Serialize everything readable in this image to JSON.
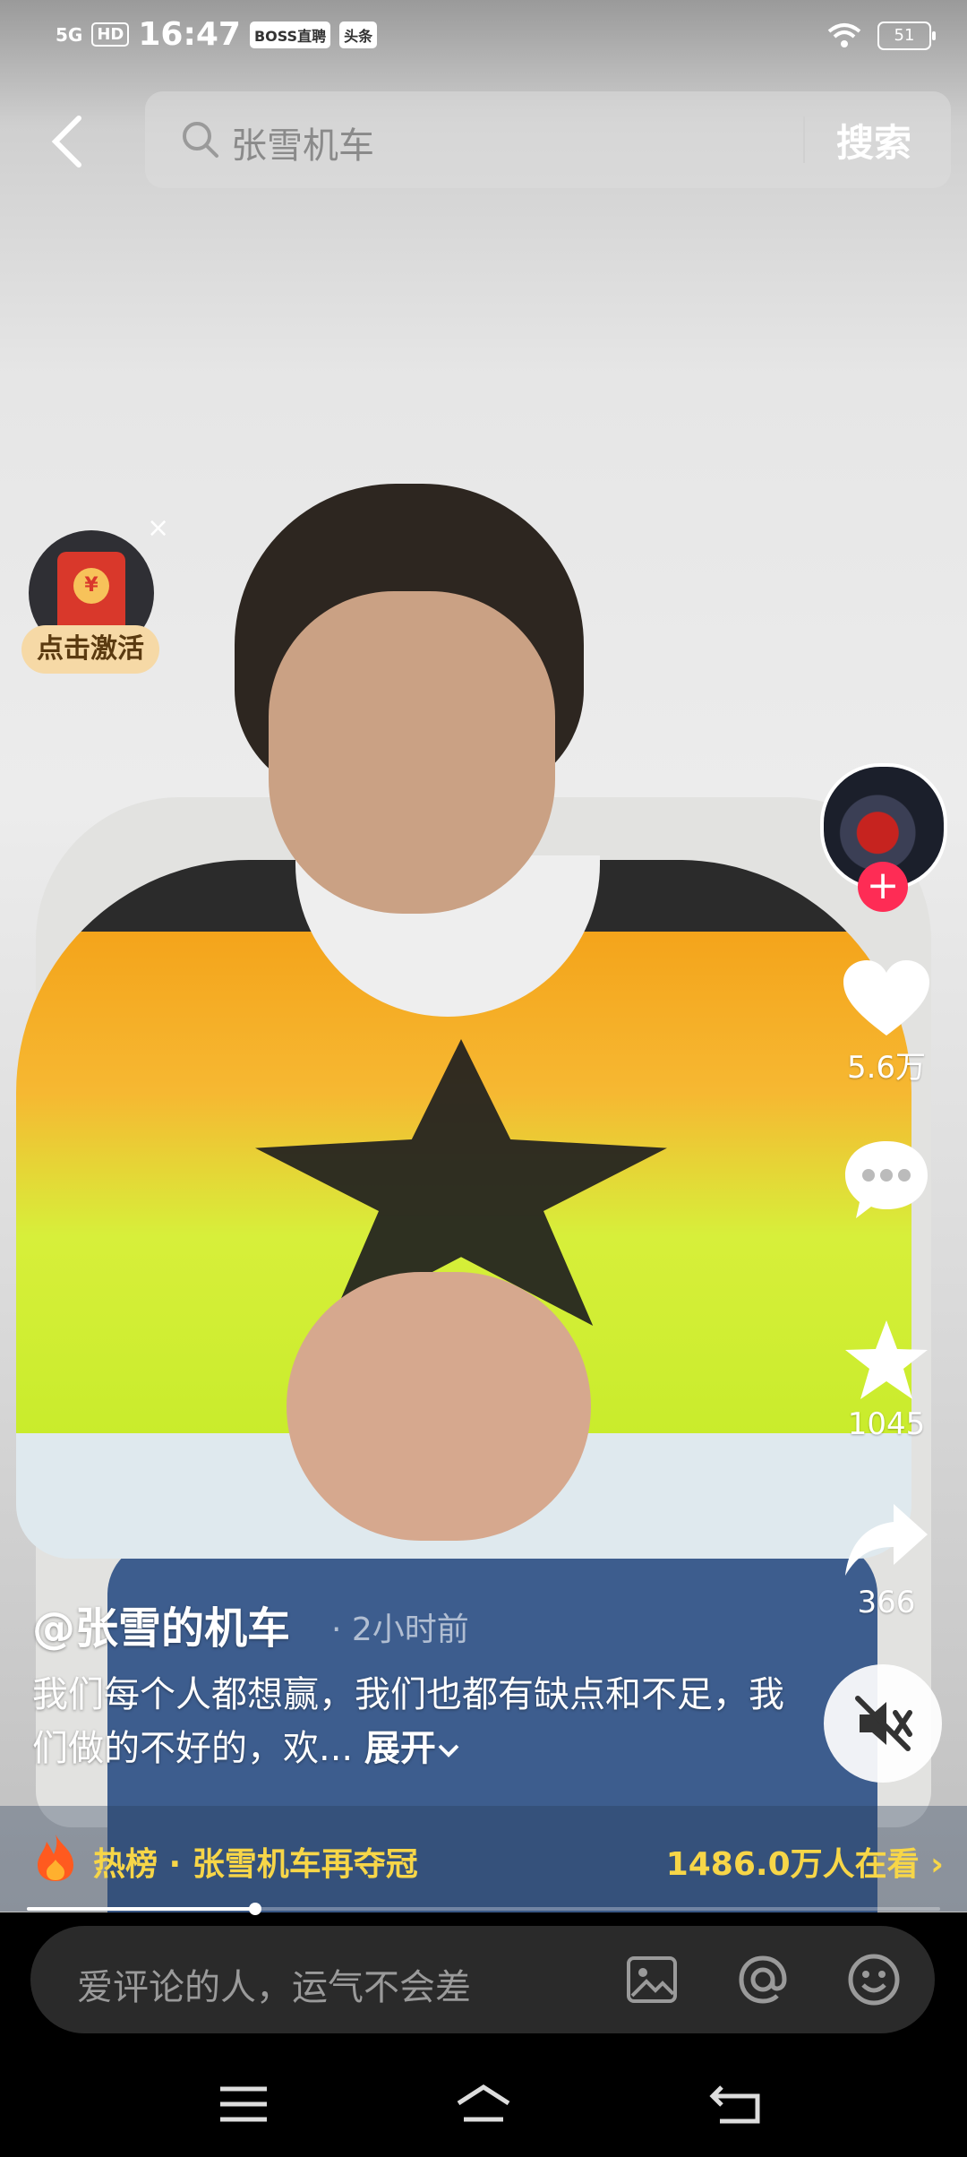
{
  "status_bar": {
    "network": "5G",
    "hd": "HD",
    "time": "16:47",
    "apps": [
      "BOSS直聘",
      "头条"
    ],
    "battery": "51"
  },
  "search": {
    "query": "张雪机车",
    "button": "搜索"
  },
  "red_packet": {
    "label": "点击激活",
    "close": "×",
    "seal": "¥"
  },
  "actions": {
    "likes": "5.6万",
    "comments": "",
    "favorites": "1045",
    "shares": "366"
  },
  "video": {
    "author": "@张雪的机车",
    "time": "· 2小时前",
    "caption": "我们每个人都想赢，我们也都有缺点和不足，我们做的不好的，欢...",
    "expand": "展开",
    "progress": 0.25
  },
  "hot": {
    "label": "热榜 · 张雪机车再夺冠",
    "viewers": "1486.0万人在看 ›"
  },
  "comment": {
    "placeholder": "爱评论的人，运气不会差"
  },
  "icons": {
    "back": "back-icon",
    "search": "search-icon",
    "like": "heart-icon",
    "comment": "comment-icon",
    "favorite": "star-icon",
    "share": "share-icon",
    "mute": "mute-icon",
    "image": "image-icon",
    "mention": "at-icon",
    "emoji": "emoji-icon",
    "menu": "menu-icon",
    "home": "home-icon",
    "nav_back": "nav-back-icon"
  },
  "colors": {
    "accent": "#fe2c55",
    "hot": "#f7d648"
  }
}
